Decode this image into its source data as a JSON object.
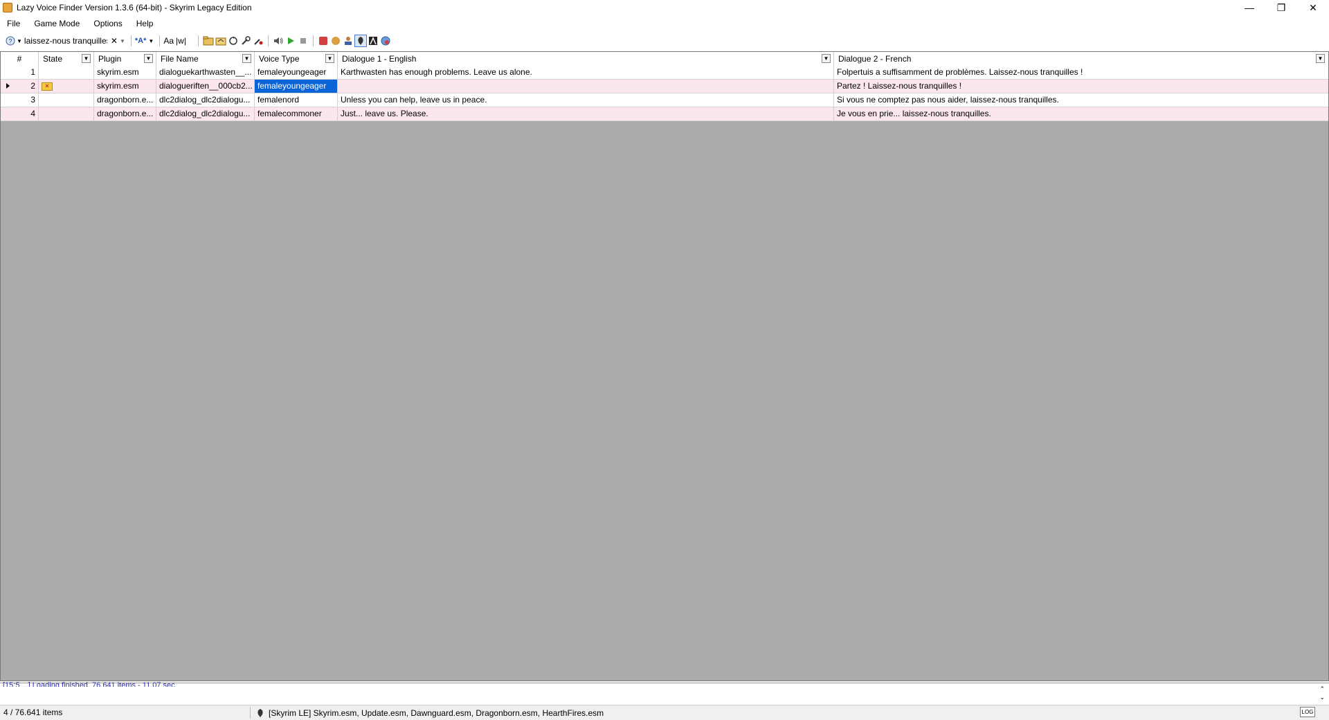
{
  "window": {
    "title": "Lazy Voice Finder Version 1.3.6 (64-bit) - Skyrim Legacy Edition",
    "controls": {
      "minimize": "—",
      "restore": "❐",
      "close": "✕"
    }
  },
  "menu": [
    "File",
    "Game Mode",
    "Options",
    "Help"
  ],
  "toolbar": {
    "search_value": "laissez-nous tranquilles",
    "clear": "✕",
    "case_label": "Aa",
    "word_label": "|w|",
    "filter_label": "*A*"
  },
  "table": {
    "columns": [
      "#",
      "State",
      "Plugin",
      "File Name",
      "Voice Type",
      "Dialogue 1 - English",
      "Dialogue 2 - French"
    ],
    "rows": [
      {
        "num": "1",
        "state": "",
        "plugin": "skyrim.esm",
        "file": "dialoguekarthwasten__...",
        "voice": "femaleyoungeager",
        "d1": "Karthwasten has enough problems. Leave us alone.",
        "d2": "Folpertuis a suffisamment de problèmes. Laissez-nous tranquilles !"
      },
      {
        "num": "2",
        "state": "icon",
        "plugin": "skyrim.esm",
        "file": "dialogueriften__000cb2...",
        "voice": "femaleyoungeager",
        "d1": "",
        "d2": "Partez ! Laissez-nous tranquilles !"
      },
      {
        "num": "3",
        "state": "",
        "plugin": "dragonborn.e...",
        "file": "dlc2dialog_dlc2dialogu...",
        "voice": "femalenord",
        "d1": "Unless you can help, leave us in peace.",
        "d2": "Si vous ne comptez pas nous aider, laissez-nous tranquilles."
      },
      {
        "num": "4",
        "state": "",
        "plugin": "dragonborn.e...",
        "file": "dlc2dialog_dlc2dialogu...",
        "voice": "femalecommoner",
        "d1": "Just... leave us. Please.",
        "d2": "Je vous en prie... laissez-nous tranquilles."
      }
    ]
  },
  "log": {
    "text": "[15:5 ...] Loading finished. 76.641 items - 11,07 sec."
  },
  "status": {
    "count": "4 / 76.641 items",
    "plugins": "[Skyrim LE] Skyrim.esm, Update.esm, Dawnguard.esm, Dragonborn.esm, HearthFires.esm",
    "log_button": "LOG"
  }
}
